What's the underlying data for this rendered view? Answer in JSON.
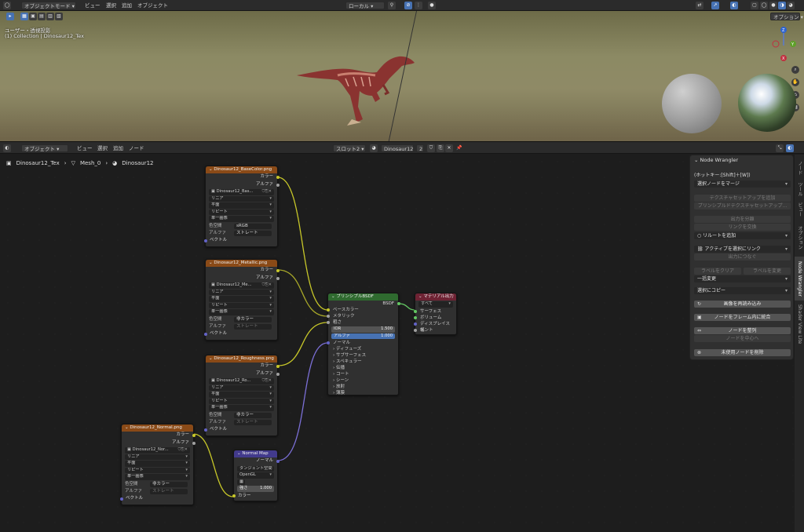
{
  "top_header": {
    "mode": "オブジェクトモード",
    "menus": [
      "ビュー",
      "選択",
      "追加",
      "オブジェクト"
    ],
    "transform_orientation": "ローカル",
    "options": "オプション"
  },
  "viewport": {
    "view_name": "ユーザー・透視投影",
    "collection": "(1) Collection | Dinosaur12_Tex",
    "gizmo_axes": [
      "Z",
      "Y",
      "X"
    ]
  },
  "node_header": {
    "mode": "オブジェクト",
    "menus": [
      "ビュー",
      "選択",
      "追加",
      "ノード"
    ],
    "slot": "スロット2",
    "material": "Dinosaur12",
    "users": "2"
  },
  "breadcrumb": {
    "object": "Dinosaur12_Tex",
    "mesh": "Mesh_0",
    "material": "Dinosaur12"
  },
  "nodes": {
    "basecolor": {
      "title": "Dinosaur12_BaseColor.png",
      "out_color": "カラー",
      "out_alpha": "アルファ",
      "image": "Dinosaur12_Bas...",
      "interp": "リニア",
      "proj": "平面",
      "ext": "リピート",
      "src": "単一画像",
      "colorspace_label": "色空間",
      "colorspace": "sRGB",
      "alpha_label": "アルファ",
      "alpha": "ストレート",
      "vector": "ベクトル"
    },
    "metallic": {
      "title": "Dinosaur12_Metallic.png",
      "out_color": "カラー",
      "out_alpha": "アルファ",
      "image": "Dinosaur12_Me...",
      "interp": "リニア",
      "proj": "平面",
      "ext": "リピート",
      "src": "単一画像",
      "colorspace_label": "色空間",
      "colorspace": "非カラー",
      "alpha_label": "アルファ",
      "alpha": "ストレート",
      "vector": "ベクトル"
    },
    "roughness": {
      "title": "Dinosaur12_Roughness.png",
      "out_color": "カラー",
      "out_alpha": "アルファ",
      "image": "Dinosaur12_Ro...",
      "interp": "リニア",
      "proj": "平面",
      "ext": "リピート",
      "src": "単一画像",
      "colorspace_label": "色空間",
      "colorspace": "非カラー",
      "alpha_label": "アルファ",
      "alpha": "ストレート",
      "vector": "ベクトル"
    },
    "normal": {
      "title": "Dinosaur12_Normal.png",
      "out_color": "カラー",
      "out_alpha": "アルファ",
      "image": "Dinosaur12_Nor...",
      "interp": "リニア",
      "proj": "平面",
      "ext": "リピート",
      "src": "単一画像",
      "colorspace_label": "色空間",
      "colorspace": "非カラー",
      "alpha_label": "アルファ",
      "alpha": "ストレート",
      "vector": "ベクトル"
    },
    "normalmap": {
      "title": "Normal Map",
      "out": "ノーマル",
      "space": "タンジェント空間",
      "uv": "OpenGL",
      "strength_label": "強さ",
      "strength": "1.000",
      "in_color": "カラー"
    },
    "bsdf": {
      "title": "プリンシプルBSDF",
      "out": "BSDF",
      "base_color": "ベースカラー",
      "metallic": "メタリック",
      "roughness": "粗さ",
      "ior_label": "IOR",
      "ior": "1.500",
      "alpha_label": "アルファ",
      "alpha": "1.000",
      "normal": "ノーマル",
      "panels": [
        "ディフューズ",
        "サブサーフェス",
        "スペキュラー",
        "伝播",
        "コート",
        "シーン",
        "放射",
        "薄膜"
      ]
    },
    "output": {
      "title": "マテリアル出力",
      "target": "すべて",
      "surface": "サーフェス",
      "volume": "ボリューム",
      "displacement": "ディスプレイスメント",
      "thickness": "幅"
    }
  },
  "npanel": {
    "title": "Node Wrangler",
    "hotkey": "(ホットキー:[Shift]＋[W])",
    "select_merge": "選択ノードをマージ",
    "tex_setup": "テクスチャセットアップを追加",
    "principled_setup": "プリンシプルドテクスチャセットアップ...",
    "output_split": "出力を分離",
    "swap_links": "リンクを交換",
    "add_reroute": "リルートを追加",
    "link_active": "アクティブを選択にリンク",
    "connect_output": "出力につなぐ",
    "clear_label": "ラベルをクリア",
    "modify_label": "ラベルを変更",
    "batch_change": "一括変更",
    "copy_to_selected": "選択にコピー",
    "reload_images": "画像を再読み込み",
    "frame_selected": "ノードをフレーム内に統合",
    "align_nodes": "ノードを整列",
    "center_nodes": "ノードを中心へ",
    "delete_unused": "未使用ノードを削除"
  },
  "side_tabs": [
    "ノード",
    "ツール",
    "ビュー",
    "オプション",
    "Node Wrangler",
    "Shader View Lite"
  ],
  "colors": {
    "accent": "#4772b3",
    "tex_header": "#8a4a17",
    "bsdf_header": "#2f6a2f",
    "output_header": "#6e2233",
    "vector_header": "#423a8c"
  }
}
